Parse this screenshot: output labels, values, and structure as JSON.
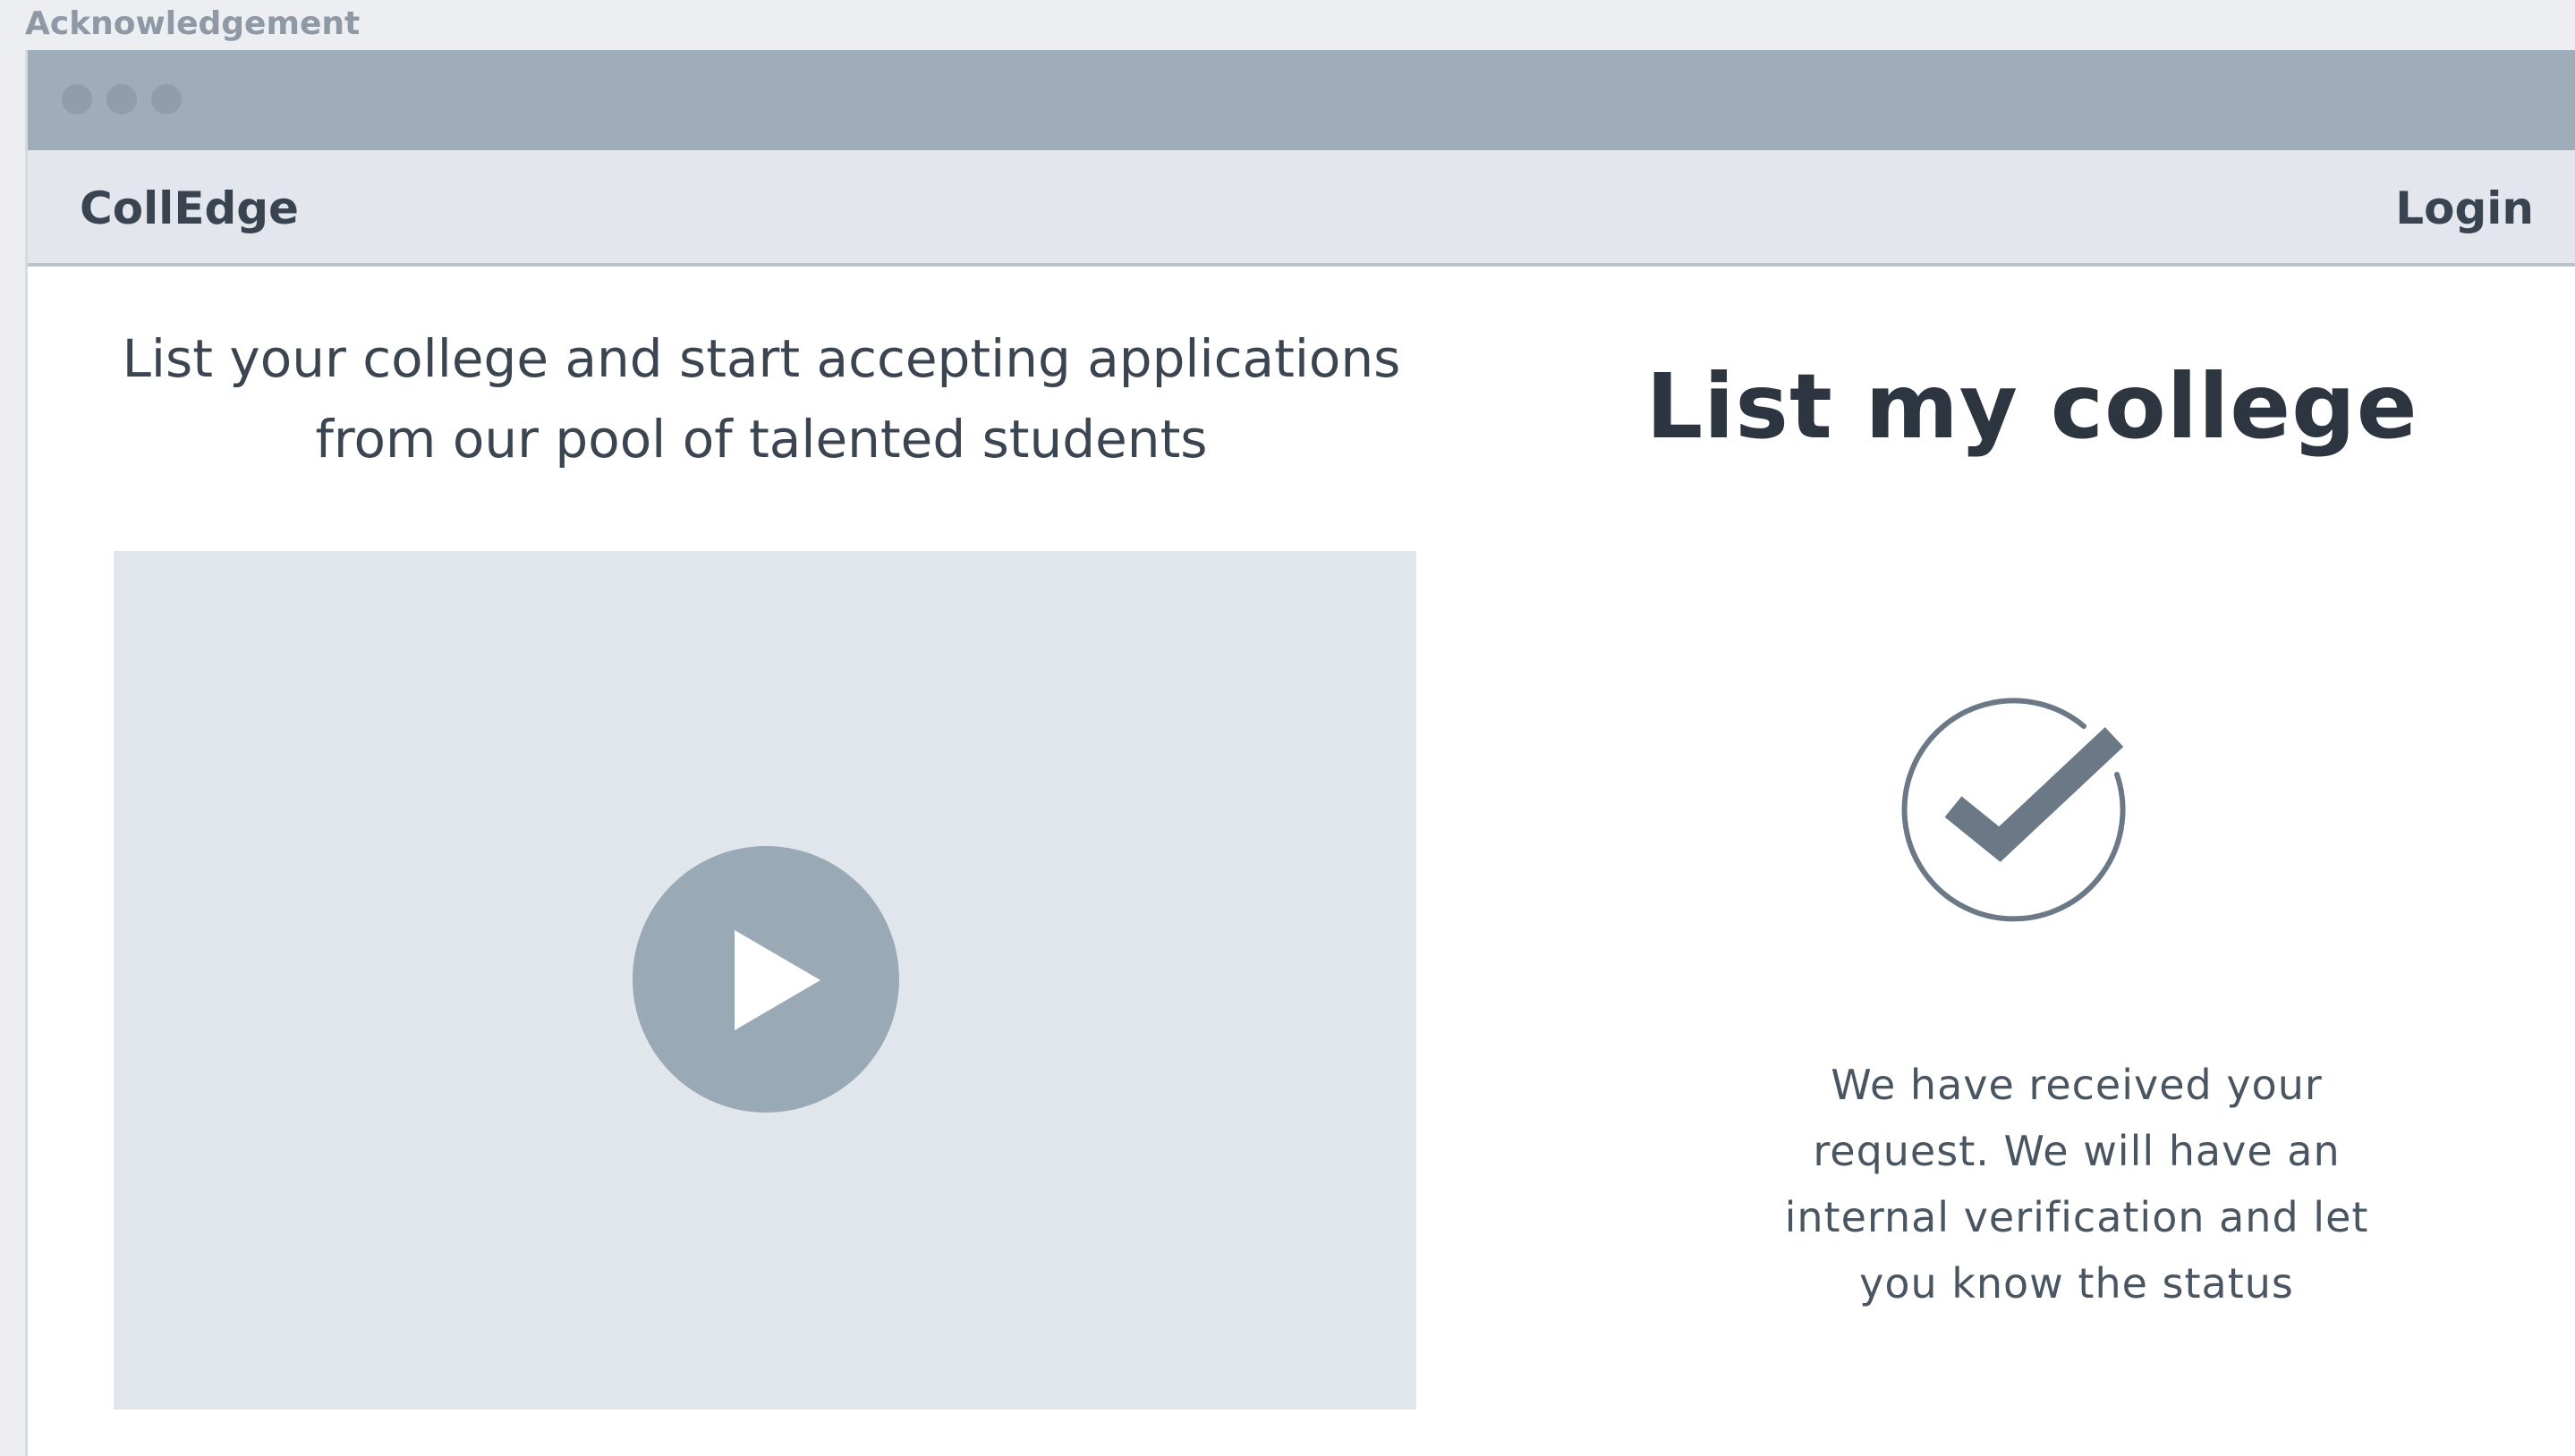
{
  "frame": {
    "label": "Acknowledgement"
  },
  "navbar": {
    "brand": "CollEdge",
    "login_label": "Login"
  },
  "hero": {
    "tagline_line1": "List your college and start accepting applications",
    "tagline_line2": "from our pool of talented students"
  },
  "video": {
    "play_icon": "play-icon"
  },
  "form": {
    "title": "List my college",
    "status_icon": "check-circle-icon",
    "message_line1": "We have received your",
    "message_line2": "request. We will have an",
    "message_line3": "internal verification and let",
    "message_line4": "you know the status"
  },
  "colors": {
    "titlebar": "#9eadb9",
    "navbar": "#e3e7ed",
    "video_bg": "#e1e6ec",
    "play_button": "#9aa9b6",
    "check_stroke": "#6b7987",
    "text_dark": "#2c3540"
  }
}
